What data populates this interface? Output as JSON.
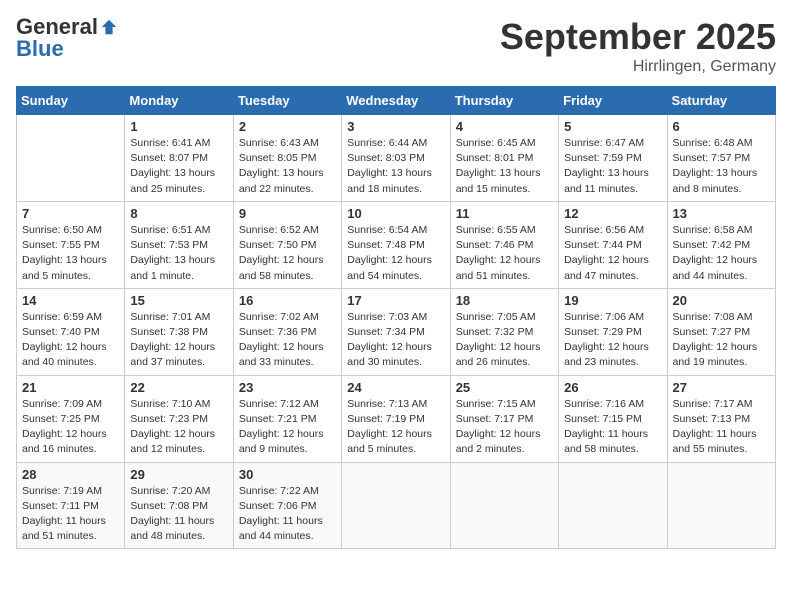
{
  "header": {
    "logo": {
      "general": "General",
      "blue": "Blue",
      "tagline": ""
    },
    "title": "September 2025",
    "location": "Hirrlingen, Germany"
  },
  "weekdays": [
    "Sunday",
    "Monday",
    "Tuesday",
    "Wednesday",
    "Thursday",
    "Friday",
    "Saturday"
  ],
  "weeks": [
    [
      {
        "day": null,
        "info": null
      },
      {
        "day": "1",
        "sunrise": "6:41 AM",
        "sunset": "8:07 PM",
        "daylight": "13 hours and 25 minutes."
      },
      {
        "day": "2",
        "sunrise": "6:43 AM",
        "sunset": "8:05 PM",
        "daylight": "13 hours and 22 minutes."
      },
      {
        "day": "3",
        "sunrise": "6:44 AM",
        "sunset": "8:03 PM",
        "daylight": "13 hours and 18 minutes."
      },
      {
        "day": "4",
        "sunrise": "6:45 AM",
        "sunset": "8:01 PM",
        "daylight": "13 hours and 15 minutes."
      },
      {
        "day": "5",
        "sunrise": "6:47 AM",
        "sunset": "7:59 PM",
        "daylight": "13 hours and 11 minutes."
      },
      {
        "day": "6",
        "sunrise": "6:48 AM",
        "sunset": "7:57 PM",
        "daylight": "13 hours and 8 minutes."
      }
    ],
    [
      {
        "day": "7",
        "sunrise": "6:50 AM",
        "sunset": "7:55 PM",
        "daylight": "13 hours and 5 minutes."
      },
      {
        "day": "8",
        "sunrise": "6:51 AM",
        "sunset": "7:53 PM",
        "daylight": "13 hours and 1 minute."
      },
      {
        "day": "9",
        "sunrise": "6:52 AM",
        "sunset": "7:50 PM",
        "daylight": "12 hours and 58 minutes."
      },
      {
        "day": "10",
        "sunrise": "6:54 AM",
        "sunset": "7:48 PM",
        "daylight": "12 hours and 54 minutes."
      },
      {
        "day": "11",
        "sunrise": "6:55 AM",
        "sunset": "7:46 PM",
        "daylight": "12 hours and 51 minutes."
      },
      {
        "day": "12",
        "sunrise": "6:56 AM",
        "sunset": "7:44 PM",
        "daylight": "12 hours and 47 minutes."
      },
      {
        "day": "13",
        "sunrise": "6:58 AM",
        "sunset": "7:42 PM",
        "daylight": "12 hours and 44 minutes."
      }
    ],
    [
      {
        "day": "14",
        "sunrise": "6:59 AM",
        "sunset": "7:40 PM",
        "daylight": "12 hours and 40 minutes."
      },
      {
        "day": "15",
        "sunrise": "7:01 AM",
        "sunset": "7:38 PM",
        "daylight": "12 hours and 37 minutes."
      },
      {
        "day": "16",
        "sunrise": "7:02 AM",
        "sunset": "7:36 PM",
        "daylight": "12 hours and 33 minutes."
      },
      {
        "day": "17",
        "sunrise": "7:03 AM",
        "sunset": "7:34 PM",
        "daylight": "12 hours and 30 minutes."
      },
      {
        "day": "18",
        "sunrise": "7:05 AM",
        "sunset": "7:32 PM",
        "daylight": "12 hours and 26 minutes."
      },
      {
        "day": "19",
        "sunrise": "7:06 AM",
        "sunset": "7:29 PM",
        "daylight": "12 hours and 23 minutes."
      },
      {
        "day": "20",
        "sunrise": "7:08 AM",
        "sunset": "7:27 PM",
        "daylight": "12 hours and 19 minutes."
      }
    ],
    [
      {
        "day": "21",
        "sunrise": "7:09 AM",
        "sunset": "7:25 PM",
        "daylight": "12 hours and 16 minutes."
      },
      {
        "day": "22",
        "sunrise": "7:10 AM",
        "sunset": "7:23 PM",
        "daylight": "12 hours and 12 minutes."
      },
      {
        "day": "23",
        "sunrise": "7:12 AM",
        "sunset": "7:21 PM",
        "daylight": "12 hours and 9 minutes."
      },
      {
        "day": "24",
        "sunrise": "7:13 AM",
        "sunset": "7:19 PM",
        "daylight": "12 hours and 5 minutes."
      },
      {
        "day": "25",
        "sunrise": "7:15 AM",
        "sunset": "7:17 PM",
        "daylight": "12 hours and 2 minutes."
      },
      {
        "day": "26",
        "sunrise": "7:16 AM",
        "sunset": "7:15 PM",
        "daylight": "11 hours and 58 minutes."
      },
      {
        "day": "27",
        "sunrise": "7:17 AM",
        "sunset": "7:13 PM",
        "daylight": "11 hours and 55 minutes."
      }
    ],
    [
      {
        "day": "28",
        "sunrise": "7:19 AM",
        "sunset": "7:11 PM",
        "daylight": "11 hours and 51 minutes."
      },
      {
        "day": "29",
        "sunrise": "7:20 AM",
        "sunset": "7:08 PM",
        "daylight": "11 hours and 48 minutes."
      },
      {
        "day": "30",
        "sunrise": "7:22 AM",
        "sunset": "7:06 PM",
        "daylight": "11 hours and 44 minutes."
      },
      {
        "day": null,
        "info": null
      },
      {
        "day": null,
        "info": null
      },
      {
        "day": null,
        "info": null
      },
      {
        "day": null,
        "info": null
      }
    ]
  ],
  "labels": {
    "sunrise": "Sunrise:",
    "sunset": "Sunset:",
    "daylight": "Daylight:"
  }
}
